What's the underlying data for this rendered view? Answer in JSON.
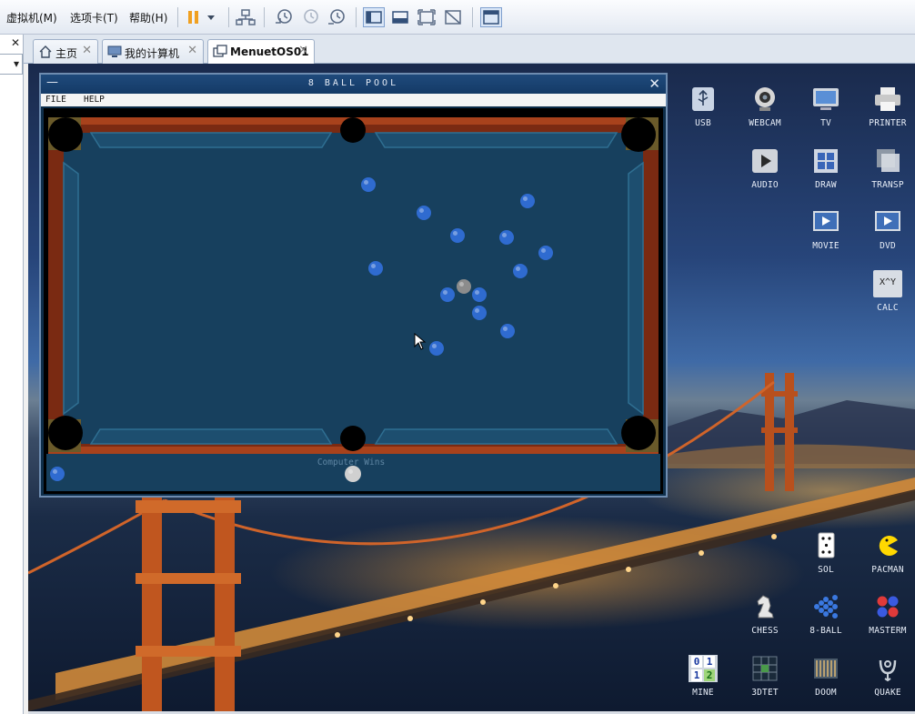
{
  "menubar": {
    "items": [
      "虚拟机(M)",
      "选项卡(T)",
      "帮助(H)"
    ]
  },
  "left_panel": {
    "close_glyph": "✕",
    "dropdown_glyph": "▾"
  },
  "tabs": [
    {
      "label": "主页",
      "icon": "home-icon",
      "close": "✕"
    },
    {
      "label": "我的计算机",
      "icon": "computer-icon",
      "close": "✕"
    },
    {
      "label": "MenuetOS01",
      "icon": "vm-icon",
      "close": "✕",
      "active": true
    }
  ],
  "pool_window": {
    "title": "8 BALL POOL",
    "minimize_glyph": "—",
    "close_glyph": "✕",
    "menu": [
      "FILE",
      "HELP"
    ],
    "status": "Computer Wins"
  },
  "desktop_icons": [
    {
      "id": "usb",
      "label": "USB",
      "icon": "usb-icon"
    },
    {
      "id": "webcam",
      "label": "WEBCAM",
      "icon": "webcam-icon"
    },
    {
      "id": "tv",
      "label": "TV",
      "icon": "tv-icon"
    },
    {
      "id": "printer",
      "label": "PRINTER",
      "icon": "printer-icon"
    },
    {
      "id": "audio",
      "label": "AUDIO",
      "icon": "play-icon"
    },
    {
      "id": "draw",
      "label": "DRAW",
      "icon": "draw-icon"
    },
    {
      "id": "transp",
      "label": "TRANSP",
      "icon": "transparency-icon"
    },
    {
      "id": "movie",
      "label": "MOVIE",
      "icon": "movie-icon"
    },
    {
      "id": "dvd",
      "label": "DVD",
      "icon": "dvd-icon"
    },
    {
      "id": "calc",
      "label": "CALC",
      "icon": "calculator-icon",
      "glyph": "X^Y"
    },
    {
      "id": "sol",
      "label": "SOL",
      "icon": "playing-card-icon"
    },
    {
      "id": "pacman",
      "label": "PACMAN",
      "icon": "pacman-icon"
    },
    {
      "id": "chess",
      "label": "CHESS",
      "icon": "chess-knight-icon"
    },
    {
      "id": "8ball",
      "label": "8-BALL",
      "icon": "ball-rack-icon"
    },
    {
      "id": "mastermind",
      "label": "MASTERM",
      "icon": "mastermind-icon"
    },
    {
      "id": "mine",
      "label": "MINE",
      "icon": "minesweeper-icon",
      "glyph": [
        "0",
        "1",
        "1",
        "2"
      ]
    },
    {
      "id": "3dtet",
      "label": "3DTET",
      "icon": "tetris-icon"
    },
    {
      "id": "doom",
      "label": "DOOM",
      "icon": "doom-icon"
    },
    {
      "id": "quake",
      "label": "QUAKE",
      "icon": "quake-icon"
    }
  ],
  "colors": {
    "felt": "#17405e",
    "rail": "#7a2a12",
    "ball_blue": "#2f6bd0",
    "ball_grey": "#8c8c8c",
    "cue_ball": "#d0d0d0"
  }
}
